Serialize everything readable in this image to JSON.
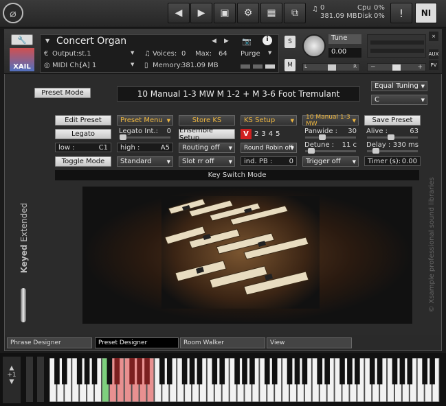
{
  "topbar": {
    "cpu_label": "Cpu",
    "cpu_value": "0%",
    "disk_label": "Disk",
    "disk_value": "0%",
    "voices_count": "0",
    "memory": "381.09 MB",
    "alert": "!",
    "ni_logo": "NI"
  },
  "header": {
    "title": "Concert Organ",
    "output_label": "Output:",
    "output_value": "st.1",
    "voices_label": "Voices:",
    "voices_value": "0",
    "max_label": "Max:",
    "max_value": "64",
    "purge_label": "Purge",
    "midi_label": "MIDI Ch:",
    "midi_value": "[A]  1",
    "memory_label": "Memory:",
    "memory_value": "381.09 MB",
    "tune_label": "Tune",
    "tune_value": "0.00",
    "pan_l": "L",
    "pan_r": "R",
    "s_label": "S",
    "m_label": "M",
    "aux_label": "AUX",
    "pv_label": "PV",
    "close_label": "×",
    "xail_label": "XAIL"
  },
  "controls": {
    "preset_mode": "Preset Mode",
    "preset_name": "10 Manual 1-3 MW M 1-2 + M 3-6 Foot Tremulant",
    "tuning": "Equal Tuning",
    "root_key": "C",
    "edit_preset": "Edit Preset",
    "preset_menu": "Preset Menu",
    "store_ks": "Store KS",
    "ks_setup": "KS Setup",
    "ks_preset": "10 Manual 1-3 MW",
    "save_preset": "Save Preset",
    "legato": "Legato",
    "legato_int_label": "Legato Int.:",
    "legato_int_value": "0",
    "ensemble_setup": "Ensemble Setup",
    "ks_numbers": [
      "V",
      "2",
      "3",
      "4",
      "5"
    ],
    "panwide_label": "Panwide :",
    "panwide_value": "30",
    "alive_label": "Alive :",
    "alive_value": "63",
    "low_label": "low :",
    "low_value": "C1",
    "high_label": "high :",
    "high_value": "A5",
    "routing": "Routing off",
    "round_robin": "Round Robin off",
    "detune_label": "Detune :",
    "detune_value": "11 c",
    "delay_label": "Delay :",
    "delay_value": "330 ms",
    "toggle_mode": "Toggle Mode",
    "standard": "Standard",
    "slot_rr": "Slot rr off",
    "ind_pb_label": "ind. PB :",
    "ind_pb_value": "0",
    "trigger": "Trigger off",
    "timer_label": "Timer (s):",
    "timer_value": "0.00",
    "ks_mode": "Key Switch Mode"
  },
  "side": {
    "keyed": "Keyed",
    "extended": "Extended",
    "brand": "© Xsample professional sound libraries"
  },
  "tabs": [
    "Phrase Designer",
    "Preset Designer",
    "Room Walker",
    "View"
  ],
  "keyboard": {
    "octave_value": "+1",
    "green_keys": 1,
    "red_keys": 6
  }
}
